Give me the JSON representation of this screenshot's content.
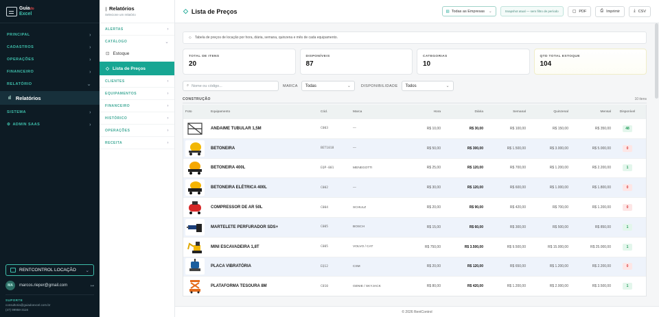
{
  "brand": {
    "logo_top": "Guia",
    "logo_sup": "do",
    "logo_bottom": "Excel"
  },
  "sidebar": {
    "groups": [
      {
        "label": "PRINCIPAL"
      },
      {
        "label": "CADASTROS"
      },
      {
        "label": "OPERAÇÕES"
      },
      {
        "label": "FINANCEIRO"
      },
      {
        "label": "RELATÓRIO"
      }
    ],
    "active": "Relatórios",
    "groups_after": [
      {
        "label": "SISTEMA"
      },
      {
        "label": "ADMIN SAAS"
      }
    ],
    "tenant": "RENTCONTROL LOCAÇÃO",
    "user_initials": "MA",
    "user_email": "marcos.rieper@gmail.com",
    "support_label": "SUPORTE",
    "support_email": "consultoria@guiadoexcel.com.br",
    "support_phone": "(47) 99958-3116"
  },
  "submenu": {
    "title": "Relatórios",
    "subtitle": "Selecione um relatório",
    "alertas": "ALERTAS",
    "catalogo": "CATÁLOGO",
    "estoque": "Estoque",
    "lista": "Lista de Preços",
    "groups": [
      "CLIENTES",
      "EQUIPAMENTOS",
      "FINANCEIRO",
      "HISTÓRICO",
      "OPERAÇÕES",
      "RECEITA"
    ]
  },
  "topbar": {
    "title": "Lista de Preços",
    "company_select": "Todas as Empresas",
    "snapshot": "Snapshot atual — sem filtro de período",
    "pdf": "PDF",
    "print": "Imprimir",
    "csv": "CSV"
  },
  "info": "Tabela de preços de locação por hora, diária, semana, quinzena e mês de cada equipamento.",
  "cards": [
    {
      "label": "TOTAL DE ITENS",
      "value": "20"
    },
    {
      "label": "DISPONÍVEIS",
      "value": "87"
    },
    {
      "label": "CATEGORIAS",
      "value": "10"
    },
    {
      "label": "QTD TOTAL ESTOQUE",
      "value": "104"
    }
  ],
  "filters": {
    "search_placeholder": "Nome ou código...",
    "marca_label": "MARCA",
    "marca_value": "Todas",
    "disp_label": "DISPONIBILIDADE",
    "disp_value": "Todos"
  },
  "section": {
    "name": "CONSTRUÇÃO",
    "count": "10 itens"
  },
  "table": {
    "headers": [
      "Foto",
      "Equipamento",
      "Cód.",
      "Marca",
      "Hora",
      "Diária",
      "Semanal",
      "Quinzenal",
      "Mensal",
      "Disponível"
    ],
    "rows": [
      {
        "name": "ANDAIME TUBULAR 1,5M",
        "code": "C003",
        "brand": "—",
        "hora": "R$ 10,00",
        "diaria": "R$ 30,00",
        "semanal": "R$ 100,00",
        "quinzenal": "R$ 150,00",
        "mensal": "R$ 350,00",
        "disp": "48"
      },
      {
        "name": "BETONEIRA",
        "code": "BET1018",
        "brand": "—",
        "hora": "R$ 50,00",
        "diaria": "R$ 300,00",
        "semanal": "R$ 1.500,00",
        "quinzenal": "R$ 3.000,00",
        "mensal": "R$ 5.000,00",
        "disp": "0"
      },
      {
        "name": "BETONEIRA 400L",
        "code": "EQP-001",
        "brand": "MENEGOTTI",
        "hora": "R$ 25,00",
        "diaria": "R$ 120,00",
        "semanal": "R$ 700,00",
        "quinzenal": "R$ 1.200,00",
        "mensal": "R$ 2.200,00",
        "disp": "1"
      },
      {
        "name": "BETONEIRA ELÉTRICA 400L",
        "code": "C002",
        "brand": "—",
        "hora": "R$ 30,00",
        "diaria": "R$ 120,00",
        "semanal": "R$ 600,00",
        "quinzenal": "R$ 1.000,00",
        "mensal": "R$ 1.800,00",
        "disp": "0"
      },
      {
        "name": "COMPRESSOR DE AR 50L",
        "code": "C004",
        "brand": "SCHULZ",
        "hora": "R$ 20,00",
        "diaria": "R$ 90,00",
        "semanal": "R$ 420,00",
        "quinzenal": "R$ 700,00",
        "mensal": "R$ 1.200,00",
        "disp": "0"
      },
      {
        "name": "MARTELETE PERFURADOR SDS+",
        "code": "C005",
        "brand": "BOSCH",
        "hora": "R$ 15,00",
        "diaria": "R$ 60,00",
        "semanal": "R$ 300,00",
        "quinzenal": "R$ 500,00",
        "mensal": "R$ 850,00",
        "disp": "1"
      },
      {
        "name": "MINI ESCAVADEIRA 1,8T",
        "code": "C005",
        "brand": "VOLVO / CAT",
        "hora": "R$ 750,00",
        "diaria": "R$ 3.500,00",
        "semanal": "R$ 9.500,00",
        "quinzenal": "R$ 15.000,00",
        "mensal": "R$ 25.000,00",
        "disp": "1"
      },
      {
        "name": "PLACA VIBRATÓRIA",
        "code": "EQ12",
        "brand": "CSM",
        "hora": "R$ 20,00",
        "diaria": "R$ 120,00",
        "semanal": "R$ 650,00",
        "quinzenal": "R$ 1.200,00",
        "mensal": "R$ 2.200,00",
        "disp": "0"
      },
      {
        "name": "PLATAFORMA TESOURA 8M",
        "code": "C010",
        "brand": "GENIE / SKYJACK",
        "hora": "R$ 80,00",
        "diaria": "R$ 420,00",
        "semanal": "R$ 1.200,00",
        "quinzenal": "R$ 2.000,00",
        "mensal": "R$ 3.500,00",
        "disp": "1"
      }
    ]
  },
  "footer": "© 2026 RentControl",
  "colors": {
    "accent": "#17a693",
    "sidebar_bg": "#0d1b24",
    "ok": "#1f9a57",
    "zero": "#d9383a"
  }
}
